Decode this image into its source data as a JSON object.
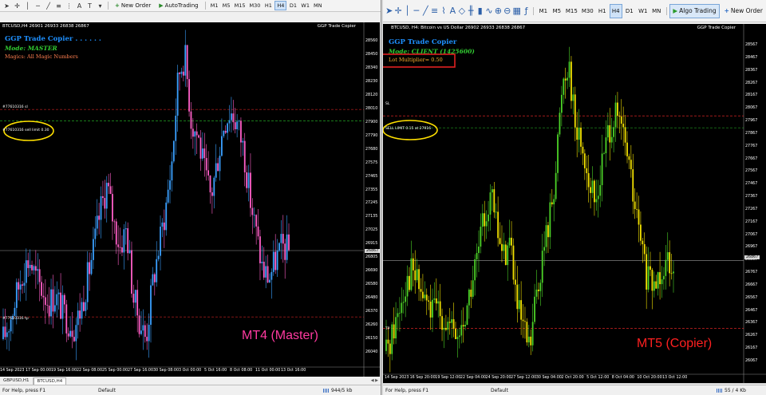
{
  "mt4": {
    "toolbar": {
      "new_order": "New Order",
      "auto_trading": "AutoTrading",
      "timeframes": [
        "M1",
        "M5",
        "M15",
        "M30",
        "H1",
        "H4",
        "D1",
        "W1",
        "MN"
      ],
      "active_timeframe": "H4"
    },
    "chart": {
      "symbol_bar": "BTCUSD,H4  26901 26933 26838 26867",
      "indicator_name": "GGP Trade Copier",
      "title": "GGP Trade Copier  . . . . . .",
      "mode": "Mode: MASTER",
      "magics": "Magics: All Magic Numbers",
      "sl_label": "#77610316 sl",
      "order_label": "#77610316 sell limit 0.30",
      "tp_label": "#77610316 tp",
      "current_price": "26867",
      "price_labels": [
        "28560",
        "28450",
        "28340",
        "28230",
        "28120",
        "28010",
        "27900",
        "27790",
        "27680",
        "27575",
        "27465",
        "27355",
        "27245",
        "27135",
        "27025",
        "26915",
        "26805",
        "26690",
        "26580",
        "26480",
        "26370",
        "26260",
        "26150",
        "26040"
      ],
      "time_labels": [
        "14 Sep 2023",
        "17 Sep 00:00",
        "19 Sep 16:00",
        "22 Sep 08:00",
        "25 Sep 00:00",
        "27 Sep 16:00",
        "30 Sep 08:00",
        "3 Oct 00:00",
        "5 Oct 16:00",
        "8 Oct 08:00",
        "11 Oct 00:00",
        "13 Oct 16:00"
      ],
      "tag": "MT4 (Master)",
      "tag_color": "#ff3aa0"
    },
    "tabs": [
      "GBPUSD,H1",
      "BTCUSD,H4"
    ],
    "active_tab": "BTCUSD,H4",
    "status": {
      "help": "For Help, press F1",
      "profile": "Default",
      "traffic": "944/5 kb"
    }
  },
  "mt5": {
    "toolbar": {
      "algo_trading": "Algo Trading",
      "new_order": "New Order",
      "timeframes": [
        "M1",
        "M5",
        "M15",
        "M30",
        "H1",
        "H4",
        "D1",
        "W1",
        "MN"
      ],
      "active_timeframe": "H4"
    },
    "chart": {
      "symbol_bar": "BTCUSD, H4:  Bitcoin vs US Dollar  26902 26933 26838 26867",
      "indicator_name": "GGP Trade Copier",
      "title": "GGP Trade Copier",
      "mode": "Mode: CLIENT (1425600)",
      "lot_multiplier": "Lot Multiplier= 0.50",
      "sl_label": "SL",
      "order_label": "SELL LIMIT 0.15 at 27916",
      "tp_label": "TP",
      "current_price": "26867",
      "price_labels": [
        "28567",
        "28467",
        "28367",
        "28267",
        "28167",
        "28067",
        "27967",
        "27867",
        "27767",
        "27667",
        "27567",
        "27467",
        "27367",
        "27267",
        "27167",
        "27067",
        "26967",
        "26867",
        "26767",
        "26667",
        "26567",
        "26467",
        "26367",
        "26267",
        "26167",
        "26067"
      ],
      "time_labels": [
        "14 Sep 2023",
        "16 Sep 20:00",
        "19 Sep 12:00",
        "22 Sep 04:00",
        "24 Sep 20:00",
        "27 Sep 12:00",
        "30 Sep 04:00",
        "2 Oct 20:00",
        "5 Oct 12:00",
        "8 Oct 04:00",
        "10 Oct 20:00",
        "13 Oct 12:00"
      ],
      "tag": "MT5 (Copier)",
      "tag_color": "#ff2020"
    },
    "status": {
      "help": "For Help, press F1",
      "profile": "Default",
      "traffic": "55 / 4 Kb"
    }
  },
  "chart_data": {
    "type": "candlestick",
    "series_prices_close_approx": [
      26150,
      26300,
      26500,
      26700,
      26800,
      26650,
      26550,
      26450,
      26500,
      26400,
      26300,
      26250,
      26400,
      26650,
      26900,
      27200,
      27400,
      27100,
      26900,
      27050,
      26500,
      26300,
      26150,
      26600,
      26900,
      27200,
      27600,
      28300,
      28450,
      27900,
      27800,
      27500,
      27300,
      27600,
      27900,
      28000,
      27900,
      27700,
      27300,
      27000,
      26700,
      26650,
      26800,
      26900,
      26867
    ],
    "current_price": 26867,
    "sl_price": 28010,
    "entry_price": 27916,
    "tp_price": 26330
  },
  "icons": {
    "new_order": "plus-icon",
    "auto_trading": "robot-icon",
    "algo_trading": "play-icon"
  },
  "colors": {
    "mt4_bull": "#3aa0ff",
    "mt4_bear": "#ff5fc8",
    "mt5_bull": "#4cd327",
    "mt5_bear": "#f2e100",
    "sl_line": "#ff2a2a",
    "entry_line": "#29c429",
    "highlight_ellipse": "#ffe000",
    "highlight_box": "#e02020"
  }
}
